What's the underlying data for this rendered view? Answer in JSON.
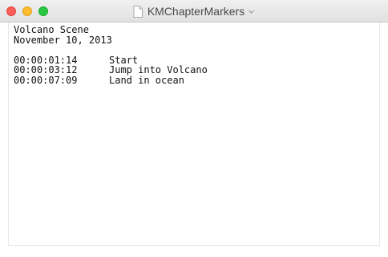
{
  "window": {
    "title": "KMChapterMarkers"
  },
  "document": {
    "scene_title": "Volcano Scene",
    "date": "November 10, 2013",
    "markers": [
      {
        "time": "00:00:01:14",
        "label": "Start"
      },
      {
        "time": "00:00:03:12",
        "label": "Jump into Volcano"
      },
      {
        "time": "00:00:07:09",
        "label": "Land in ocean"
      }
    ]
  },
  "colors": {
    "close": "#fc5f57",
    "minimize": "#fdbc2e",
    "zoom": "#28c840"
  },
  "icons": {
    "title_document": "document-icon",
    "title_menu": "chevron-down-icon"
  }
}
